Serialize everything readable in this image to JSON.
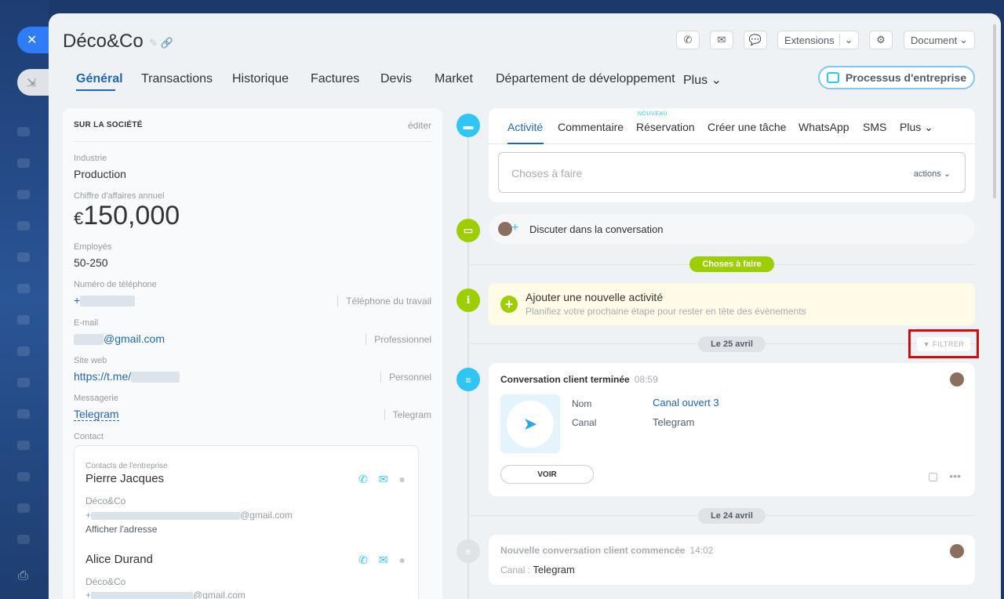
{
  "rail": {
    "close_glyph": "✕",
    "import_glyph": "⇲",
    "print_glyph": "⎙"
  },
  "header": {
    "title": "Déco&Co",
    "extensions_label": "Extensions",
    "document_label": "Document"
  },
  "tabs": [
    {
      "label": "Général"
    },
    {
      "label": "Transactions"
    },
    {
      "label": "Historique"
    },
    {
      "label": "Factures"
    },
    {
      "label": "Devis"
    },
    {
      "label": "Market"
    },
    {
      "label": "Département de développement"
    },
    {
      "label": "Plus"
    }
  ],
  "bp_button": "Processus d'entreprise",
  "about": {
    "heading": "SUR LA SOCIÉTÉ",
    "edit": "éditer",
    "industry_label": "Industrie",
    "industry": "Production",
    "revenue_label": "Chiffre d'affaires annuel",
    "revenue_currency": "€",
    "revenue": "150,000",
    "employees_label": "Employés",
    "employees": "50-250",
    "phone_label": "Numéro de téléphone",
    "phone_prefix": "+",
    "phone_type": "Téléphone du travail",
    "email_label": "E-mail",
    "email_suffix": "@gmail.com",
    "email_type": "Professionnel",
    "website_label": "Site web",
    "website_prefix": "https://t.me/",
    "website_type": "Personnel",
    "messenger_label": "Messagerie",
    "messenger": "Telegram",
    "messenger_type": "Telegram",
    "contact_label": "Contact"
  },
  "contacts": {
    "group_label": "Contacts de l'entreprise",
    "items": [
      {
        "name": "Pierre Jacques",
        "company": "Déco&Co",
        "phone_prefix": "+",
        "email_suffix": "@gmail.com",
        "address_link": "Afficher l'adresse"
      },
      {
        "name": "Alice Durand",
        "company": "Déco&Co",
        "phone_prefix": "+",
        "email_suffix": "@gmail.com"
      }
    ]
  },
  "activity": {
    "new_badge": "NOUVEAU",
    "tabs": [
      {
        "label": "Activité"
      },
      {
        "label": "Commentaire"
      },
      {
        "label": "Réservation"
      },
      {
        "label": "Créer une tâche"
      },
      {
        "label": "WhatsApp"
      },
      {
        "label": "SMS"
      },
      {
        "label": "Plus"
      }
    ],
    "placeholder": "Choses à faire",
    "actions_label": "actions"
  },
  "timeline": {
    "conversation_link": "Discuter dans la conversation",
    "todo_pill": "Choses à faire",
    "add_title": "Ajouter une nouvelle activité",
    "add_sub": "Planifiez votre prochaine étape pour rester en tête des évènements",
    "date1": "Le 25 avril",
    "filter": "FILTRER",
    "card1": {
      "title": "Conversation client terminée",
      "time": "08:59",
      "name_key": "Nom",
      "name_val": "Canal ouvert 3",
      "canal_key": "Canal",
      "canal_val": "Telegram",
      "voir": "VOIR"
    },
    "date2": "Le 24 avril",
    "card2": {
      "title": "Nouvelle conversation client commencée",
      "time": "14:02",
      "canal_label": "Canal :",
      "canal_val": "Telegram"
    }
  },
  "colors": {
    "accent": "#2067b0",
    "green": "#9dcf00",
    "cyan": "#2fc6f6",
    "highlight": "#d8090e"
  }
}
